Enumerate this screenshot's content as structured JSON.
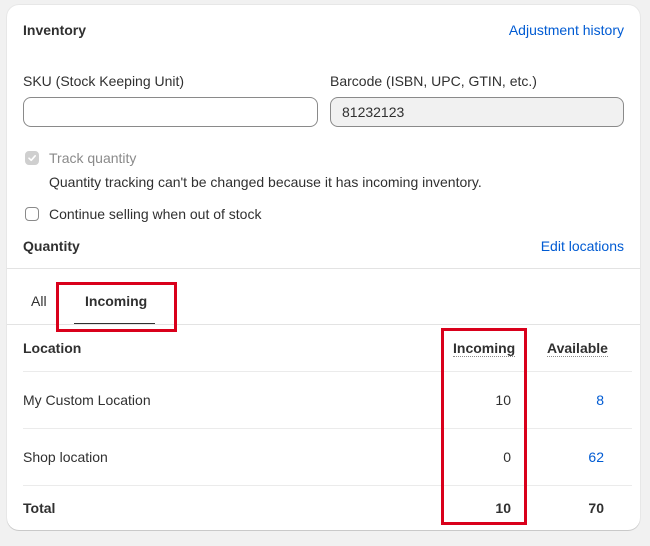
{
  "inventory": {
    "title": "Inventory",
    "adjustment_history_link": "Adjustment history",
    "sku_label": "SKU (Stock Keeping Unit)",
    "sku_value": "",
    "barcode_label": "Barcode (ISBN, UPC, GTIN, etc.)",
    "barcode_value": "81232123",
    "track_quantity_label": "Track quantity",
    "track_quantity_checked": true,
    "track_quantity_help": "Quantity tracking can't be changed because it has incoming inventory.",
    "continue_selling_label": "Continue selling when out of stock",
    "continue_selling_checked": false
  },
  "quantity": {
    "title": "Quantity",
    "edit_locations_link": "Edit locations",
    "tabs": [
      {
        "label": "All",
        "selected": false
      },
      {
        "label": "Incoming",
        "selected": true
      }
    ],
    "table": {
      "headers": {
        "location": "Location",
        "incoming": "Incoming",
        "available": "Available"
      },
      "rows": [
        {
          "location": "My Custom Location",
          "incoming": "10",
          "available": "8"
        },
        {
          "location": "Shop location",
          "incoming": "0",
          "available": "62"
        }
      ],
      "total": {
        "label": "Total",
        "incoming": "10",
        "available": "70"
      }
    }
  },
  "colors": {
    "link": "#005bd3",
    "highlight": "#d9001b",
    "text": "#303030",
    "muted": "#8a8a8a"
  }
}
